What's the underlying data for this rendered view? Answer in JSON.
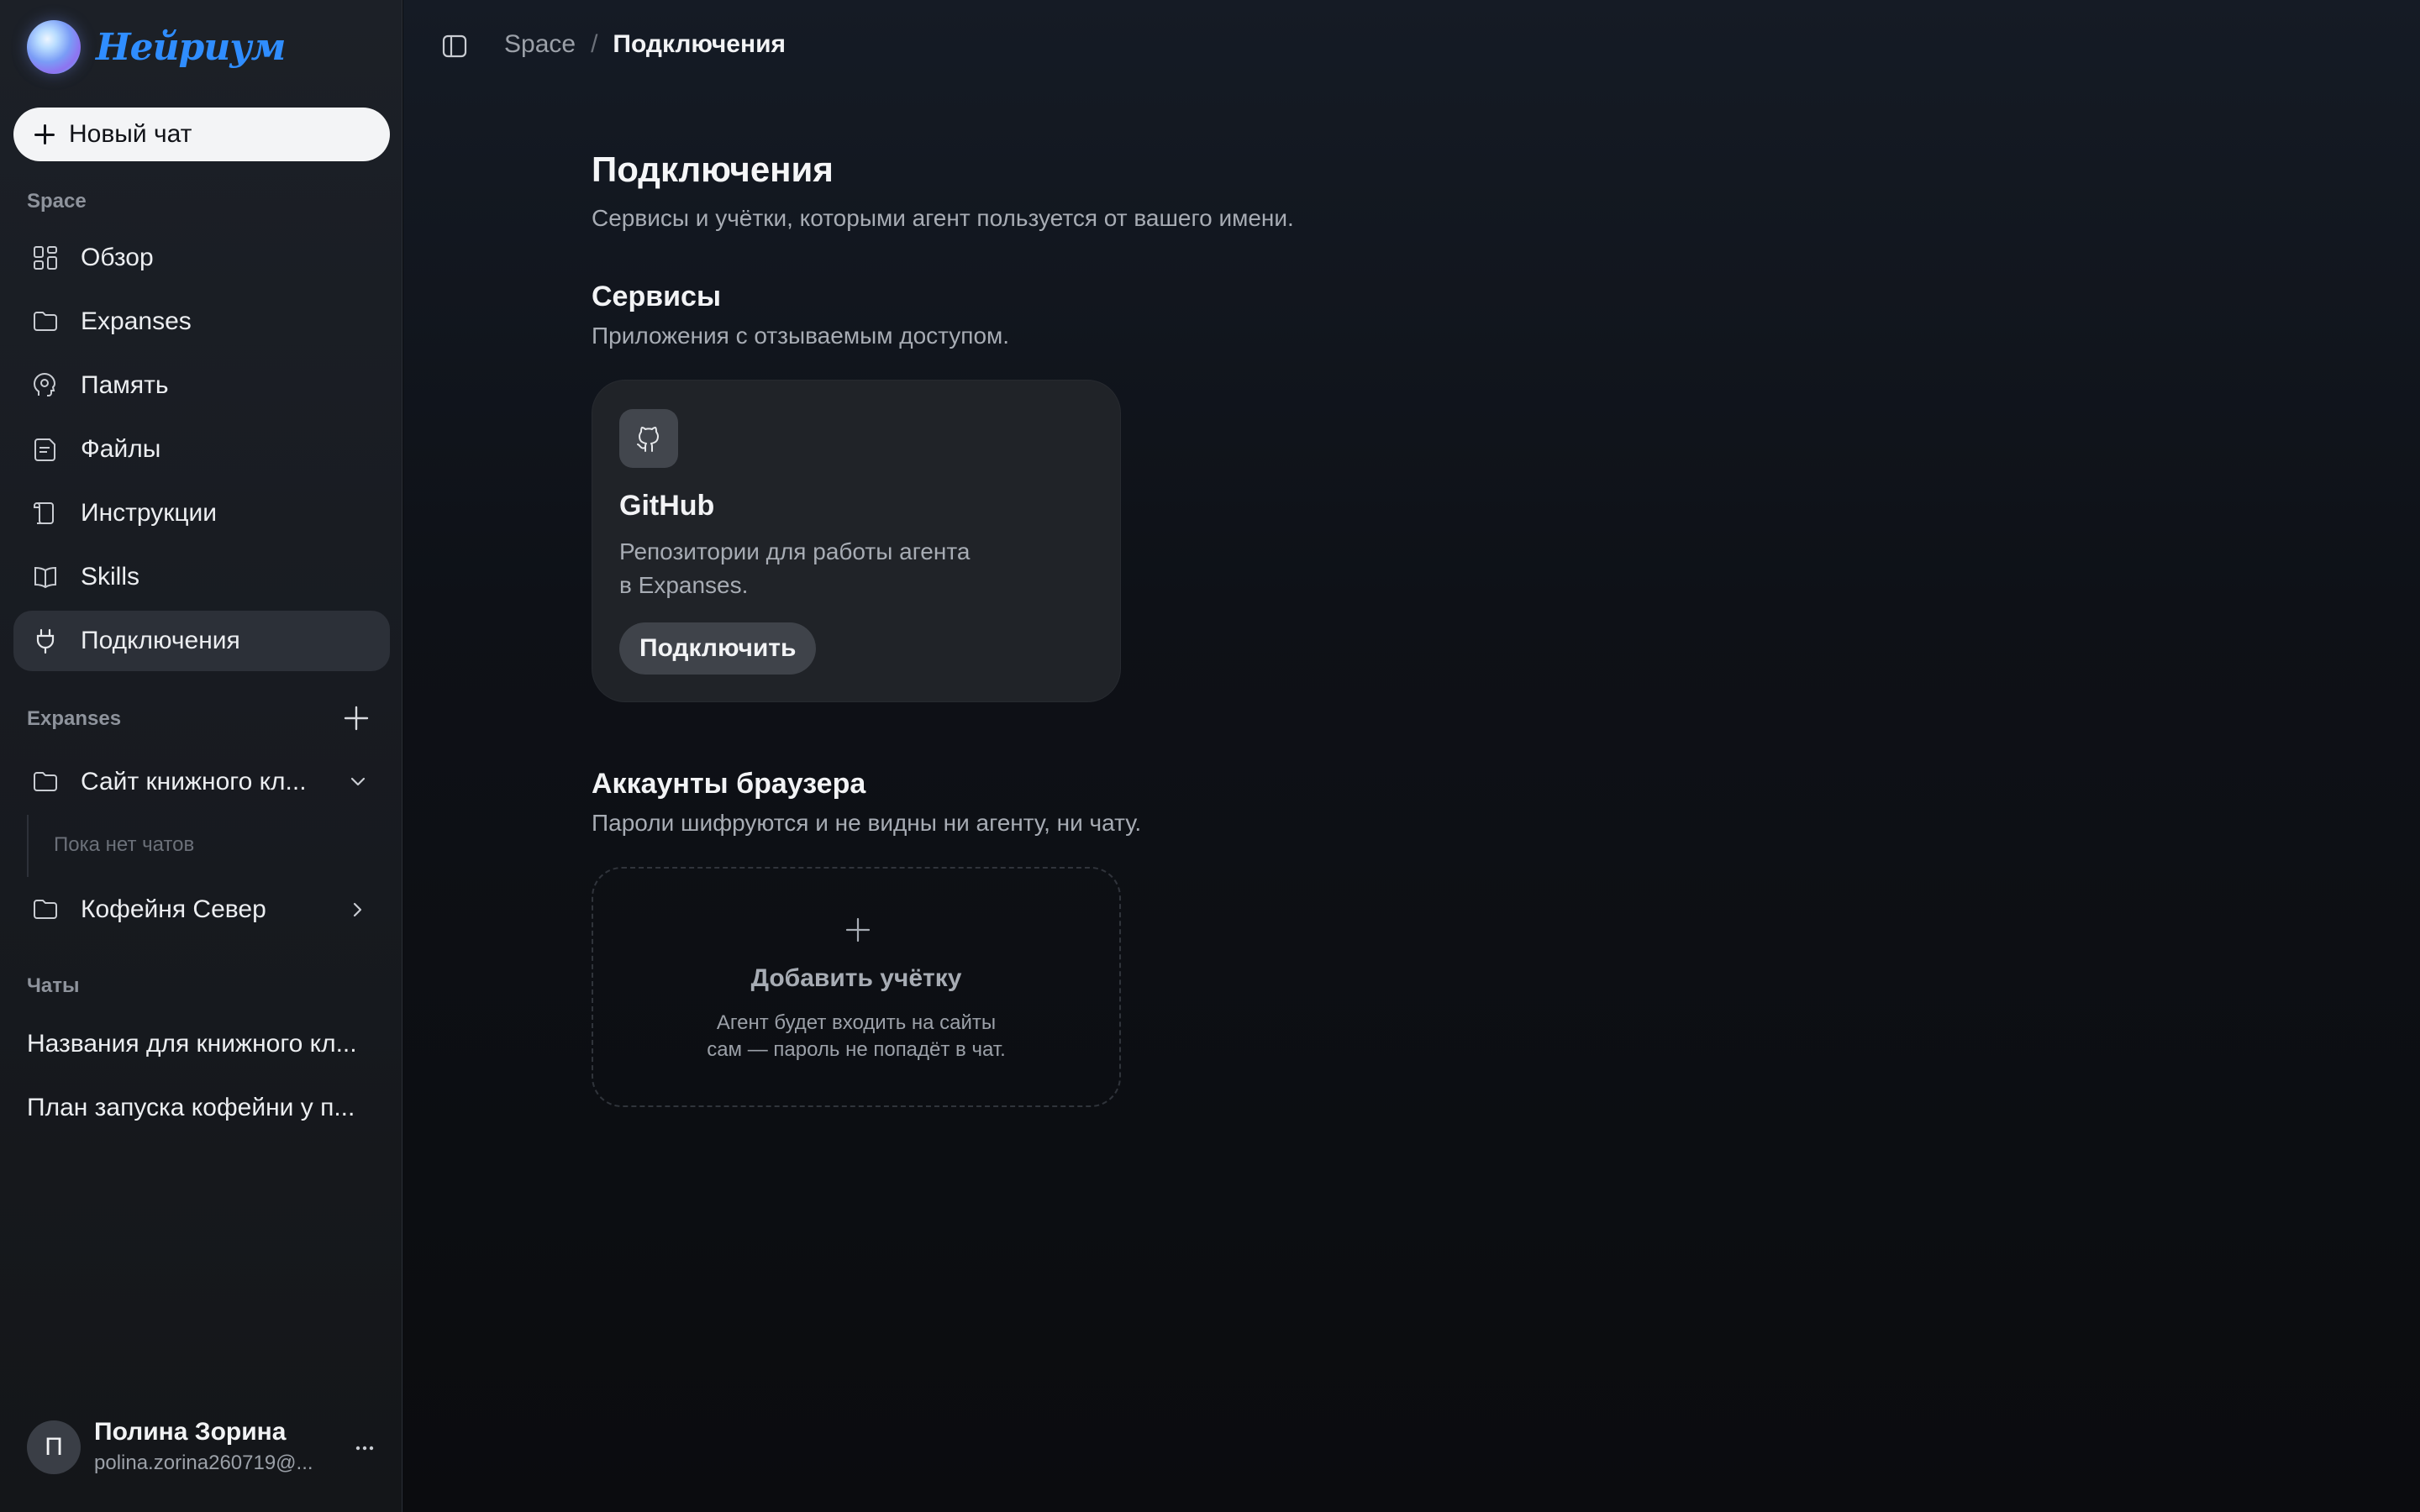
{
  "app": {
    "brand": "Нейриум"
  },
  "sidebar": {
    "new_chat": "Новый чат",
    "space_label": "Space",
    "nav": [
      {
        "label": "Обзор",
        "icon": "grid-icon"
      },
      {
        "label": "Expanses",
        "icon": "folder-icon"
      },
      {
        "label": "Память",
        "icon": "brain-icon"
      },
      {
        "label": "Файлы",
        "icon": "file-icon"
      },
      {
        "label": "Инструкции",
        "icon": "instructions-icon"
      },
      {
        "label": "Skills",
        "icon": "book-icon"
      },
      {
        "label": "Подключения",
        "icon": "plug-icon",
        "active": true
      }
    ],
    "expanses_label": "Expanses",
    "expanses": [
      {
        "label": "Сайт книжного кл...",
        "expanded": true,
        "empty_text": "Пока нет чатов"
      },
      {
        "label": "Кофейня Север",
        "expanded": false
      }
    ],
    "chats_label": "Чаты",
    "chats": [
      "Названия для книжного кл...",
      "План запуска кофейни у п..."
    ],
    "user": {
      "initial": "П",
      "name": "Полина Зорина",
      "email": "polina.zorina260719@..."
    }
  },
  "header": {
    "breadcrumb_root": "Space",
    "breadcrumb_sep": "/",
    "breadcrumb_current": "Подключения"
  },
  "page": {
    "title": "Подключения",
    "subtitle": "Сервисы и учётки, которыми агент пользуется от вашего имени.",
    "services": {
      "title": "Сервисы",
      "subtitle": "Приложения с отзываемым доступом.",
      "card": {
        "icon": "github-icon",
        "name": "GitHub",
        "desc_line1": "Репозитории для работы агента",
        "desc_line2": "в Expanses.",
        "button": "Подключить"
      }
    },
    "browser": {
      "title": "Аккаунты браузера",
      "subtitle": "Пароли шифруются и не видны ни агенту, ни чату.",
      "add": {
        "title": "Добавить учётку",
        "desc_line1": "Агент будет входить на сайты",
        "desc_line2": "сам — пароль не попадёт в чат."
      }
    }
  },
  "colors": {
    "brand": "#2f8dff",
    "sidebar_bg": "#1a1d23",
    "main_bg": "#0e1117",
    "card_bg": "#202328",
    "active_item": "#2c3038"
  }
}
